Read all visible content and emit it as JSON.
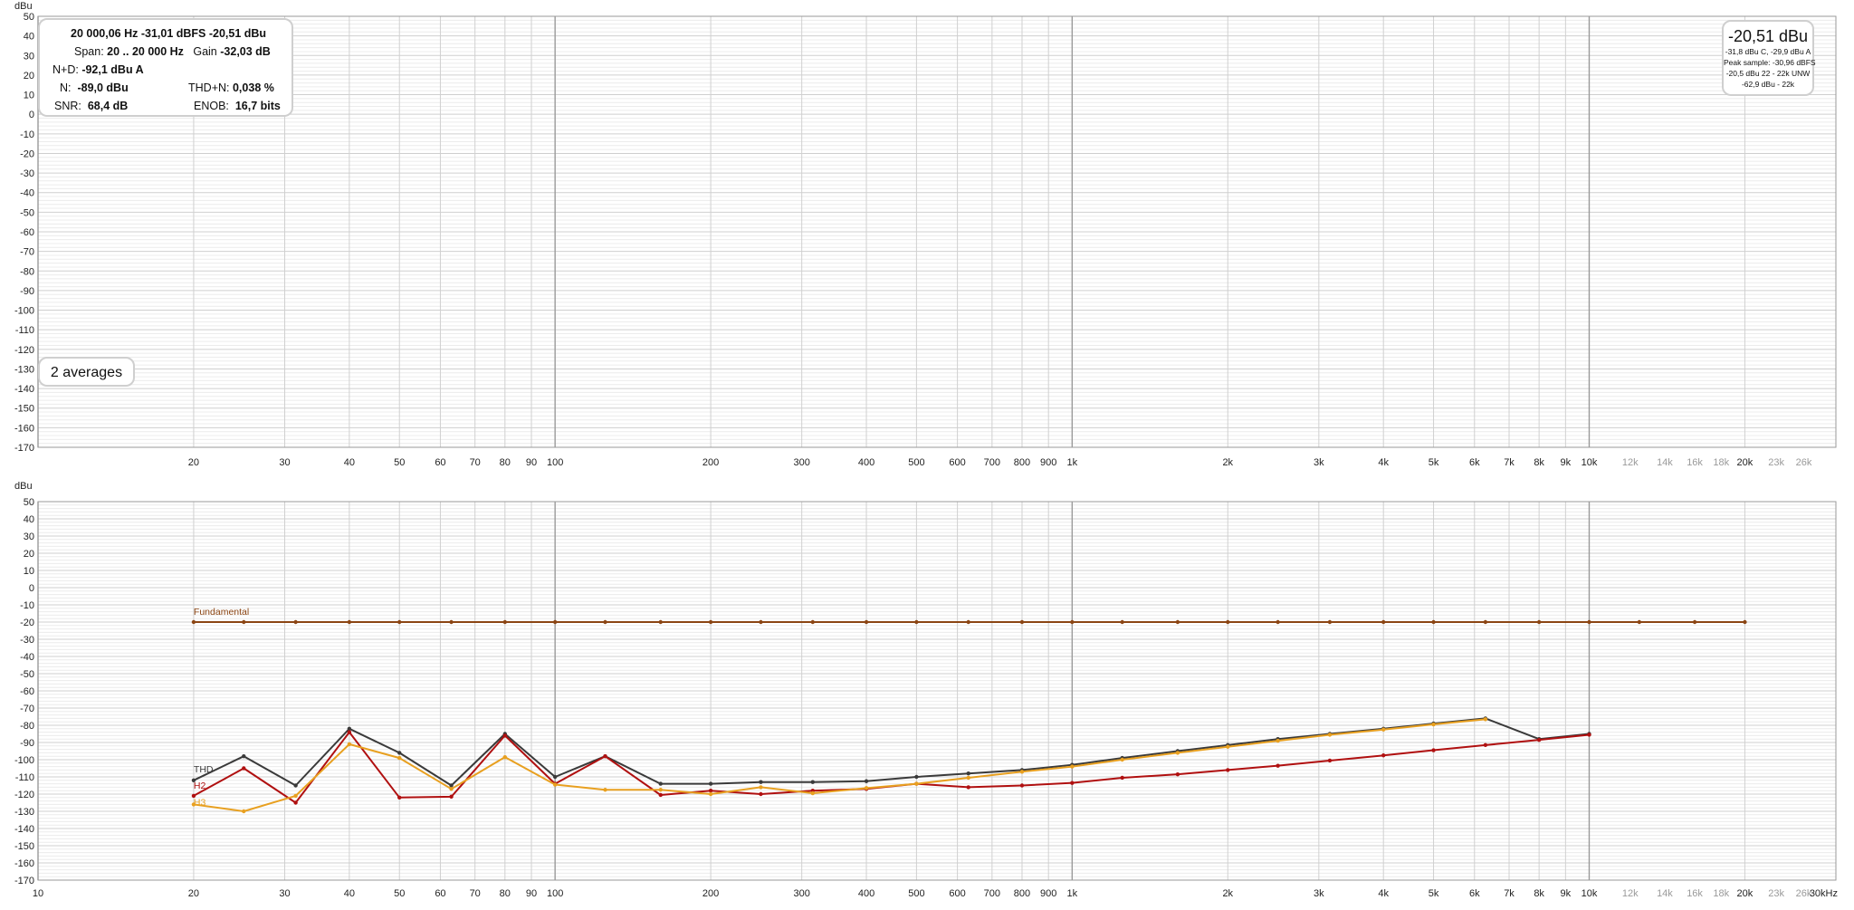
{
  "chart_data": [
    {
      "type": "line",
      "title": "",
      "ylabel": "dBu",
      "xlabel": "",
      "xscale": "log",
      "xlim": [
        10,
        30000
      ],
      "ylim": [
        -170,
        50
      ],
      "grid": true,
      "series": [],
      "y_ticks": [
        "50",
        "40",
        "30",
        "20",
        "10",
        "0",
        "-10",
        "-20",
        "-30",
        "-40",
        "-50",
        "-60",
        "-70",
        "-80",
        "-90",
        "-100",
        "-110",
        "-120",
        "-130",
        "-140",
        "-150",
        "-160",
        "-170"
      ],
      "x_ticks": [
        {
          "v": 20,
          "label": "20"
        },
        {
          "v": 30,
          "label": "30"
        },
        {
          "v": 40,
          "label": "40"
        },
        {
          "v": 50,
          "label": "50"
        },
        {
          "v": 60,
          "label": "60"
        },
        {
          "v": 70,
          "label": "70"
        },
        {
          "v": 80,
          "label": "80"
        },
        {
          "v": 90,
          "label": "90"
        },
        {
          "v": 100,
          "label": "100"
        },
        {
          "v": 200,
          "label": "200"
        },
        {
          "v": 300,
          "label": "300"
        },
        {
          "v": 400,
          "label": "400"
        },
        {
          "v": 500,
          "label": "500"
        },
        {
          "v": 600,
          "label": "600"
        },
        {
          "v": 700,
          "label": "700"
        },
        {
          "v": 800,
          "label": "800"
        },
        {
          "v": 900,
          "label": "900"
        },
        {
          "v": 1000,
          "label": "1k"
        },
        {
          "v": 2000,
          "label": "2k"
        },
        {
          "v": 3000,
          "label": "3k"
        },
        {
          "v": 4000,
          "label": "4k"
        },
        {
          "v": 5000,
          "label": "5k"
        },
        {
          "v": 6000,
          "label": "6k"
        },
        {
          "v": 7000,
          "label": "7k"
        },
        {
          "v": 8000,
          "label": "8k"
        },
        {
          "v": 9000,
          "label": "9k"
        },
        {
          "v": 10000,
          "label": "10k"
        },
        {
          "v": 12000,
          "label": "12k",
          "dim": true
        },
        {
          "v": 14000,
          "label": "14k",
          "dim": true
        },
        {
          "v": 16000,
          "label": "16k",
          "dim": true
        },
        {
          "v": 18000,
          "label": "18k",
          "dim": true
        },
        {
          "v": 20000,
          "label": "20k"
        },
        {
          "v": 23000,
          "label": "23k",
          "dim": true
        },
        {
          "v": 26000,
          "label": "26k",
          "dim": true
        }
      ]
    },
    {
      "type": "line",
      "title": "",
      "ylabel": "dBu",
      "xlabel": "",
      "xscale": "log",
      "xlim": [
        10,
        30000
      ],
      "ylim": [
        -170,
        50
      ],
      "grid": true,
      "y_ticks": [
        "50",
        "40",
        "30",
        "20",
        "10",
        "0",
        "-10",
        "-20",
        "-30",
        "-40",
        "-50",
        "-60",
        "-70",
        "-80",
        "-90",
        "-100",
        "-110",
        "-120",
        "-130",
        "-140",
        "-150",
        "-160",
        "-170"
      ],
      "x_ticks": [
        {
          "v": 10,
          "label": "10"
        },
        {
          "v": 20,
          "label": "20"
        },
        {
          "v": 30,
          "label": "30"
        },
        {
          "v": 40,
          "label": "40"
        },
        {
          "v": 50,
          "label": "50"
        },
        {
          "v": 60,
          "label": "60"
        },
        {
          "v": 70,
          "label": "70"
        },
        {
          "v": 80,
          "label": "80"
        },
        {
          "v": 90,
          "label": "90"
        },
        {
          "v": 100,
          "label": "100"
        },
        {
          "v": 200,
          "label": "200"
        },
        {
          "v": 300,
          "label": "300"
        },
        {
          "v": 400,
          "label": "400"
        },
        {
          "v": 500,
          "label": "500"
        },
        {
          "v": 600,
          "label": "600"
        },
        {
          "v": 700,
          "label": "700"
        },
        {
          "v": 800,
          "label": "800"
        },
        {
          "v": 900,
          "label": "900"
        },
        {
          "v": 1000,
          "label": "1k"
        },
        {
          "v": 2000,
          "label": "2k"
        },
        {
          "v": 3000,
          "label": "3k"
        },
        {
          "v": 4000,
          "label": "4k"
        },
        {
          "v": 5000,
          "label": "5k"
        },
        {
          "v": 6000,
          "label": "6k"
        },
        {
          "v": 7000,
          "label": "7k"
        },
        {
          "v": 8000,
          "label": "8k"
        },
        {
          "v": 9000,
          "label": "9k"
        },
        {
          "v": 10000,
          "label": "10k"
        },
        {
          "v": 12000,
          "label": "12k",
          "dim": true
        },
        {
          "v": 14000,
          "label": "14k",
          "dim": true
        },
        {
          "v": 16000,
          "label": "16k",
          "dim": true
        },
        {
          "v": 18000,
          "label": "18k",
          "dim": true
        },
        {
          "v": 20000,
          "label": "20k"
        },
        {
          "v": 23000,
          "label": "23k",
          "dim": true
        },
        {
          "v": 26000,
          "label": "26k",
          "dim": true
        },
        {
          "v": 30000,
          "label": "30kHz"
        }
      ],
      "series": [
        {
          "name": "Fundamental",
          "color": "#8b4513",
          "x": [
            20,
            25,
            31.5,
            40,
            50,
            63,
            80,
            100,
            125,
            160,
            200,
            250,
            315,
            400,
            500,
            630,
            800,
            1000,
            1250,
            1600,
            2000,
            2500,
            3150,
            4000,
            5000,
            6300,
            8000,
            10000,
            12500,
            16000,
            20000
          ],
          "y": [
            -20,
            -20,
            -20,
            -20,
            -20,
            -20,
            -20,
            -20,
            -20,
            -20,
            -20,
            -20,
            -20,
            -20,
            -20,
            -20,
            -20,
            -20,
            -20,
            -20,
            -20,
            -20,
            -20,
            -20,
            -20,
            -20,
            -20,
            -20,
            -20,
            -20,
            -20
          ]
        },
        {
          "name": "THD",
          "color": "#3a3a3a",
          "x": [
            20,
            25,
            31.5,
            40,
            50,
            63,
            80,
            100,
            125,
            160,
            200,
            250,
            315,
            400,
            500,
            630,
            800,
            1000,
            1250,
            1600,
            2000,
            2500,
            3150,
            4000,
            5000,
            6300,
            8000,
            10000
          ],
          "y": [
            -112,
            -98,
            -115,
            -82,
            -96,
            -115,
            -85,
            -110,
            -98,
            -114,
            -114,
            -113,
            -113,
            -112.5,
            -110,
            -108,
            -106,
            -103,
            -99,
            -95,
            -91.5,
            -88,
            -85,
            -82,
            -79,
            -76,
            -88,
            -85
          ]
        },
        {
          "name": "H2",
          "color": "#b01010",
          "x": [
            20,
            25,
            31.5,
            40,
            50,
            63,
            80,
            100,
            125,
            160,
            200,
            250,
            315,
            400,
            500,
            630,
            800,
            1000,
            1250,
            1600,
            2000,
            2500,
            3150,
            4000,
            5000,
            6300,
            8000,
            10000
          ],
          "y": [
            -121,
            -105,
            -125,
            -84,
            -122,
            -121.5,
            -86,
            -114,
            -98,
            -120.5,
            -118,
            -120,
            -118,
            -117,
            -114,
            -116,
            -115,
            -113.5,
            -110.5,
            -108.5,
            -106,
            -103.5,
            -100.5,
            -97.5,
            -94.5,
            -91.5,
            -88.5,
            -85.5
          ]
        },
        {
          "name": "H3",
          "color": "#e8a020",
          "x": [
            20,
            25,
            31.5,
            40,
            50,
            63,
            80,
            100,
            125,
            160,
            200,
            250,
            315,
            400,
            500,
            630,
            800,
            1000,
            1250,
            1600,
            2000,
            2500,
            3150,
            4000,
            5000,
            6300
          ],
          "y": [
            -126,
            -130,
            -121,
            -91,
            -99,
            -117,
            -98.5,
            -114.5,
            -117.5,
            -117.5,
            -120,
            -116,
            -119.5,
            -116.5,
            -114,
            -110.5,
            -107,
            -104,
            -100,
            -96,
            -92.5,
            -89,
            -85.5,
            -82.5,
            -79.5,
            -76.5
          ]
        }
      ]
    }
  ],
  "top_panel": {
    "info": {
      "line1": "20 000,06 Hz  -31,01 dBFS  -20,51 dBu",
      "span_label": "Span:",
      "span_value": "20 .. 20 000 Hz",
      "gain_label": "Gain",
      "gain_value": "-32,03 dB",
      "nd_label": "N+D:",
      "nd_value": "-92,1 dBu A",
      "n_label": "N:",
      "n_value": "-89,0 dBu",
      "thdn_label": "THD+N:",
      "thdn_value": "0,038 %",
      "snr_label": "SNR:",
      "snr_value": "68,4 dB",
      "enob_label": "ENOB:",
      "enob_value": "16,7 bits"
    },
    "averages": "2 averages",
    "level": {
      "main": "-20,51 dBu",
      "line1": "-31,8 dBu C, -29,9 dBu A",
      "line2": "Peak sample: -30,96 dBFS",
      "line3": "-20,5 dBu 22 - 22k UNW",
      "line4": "-62,9 dBu - 22k"
    }
  }
}
